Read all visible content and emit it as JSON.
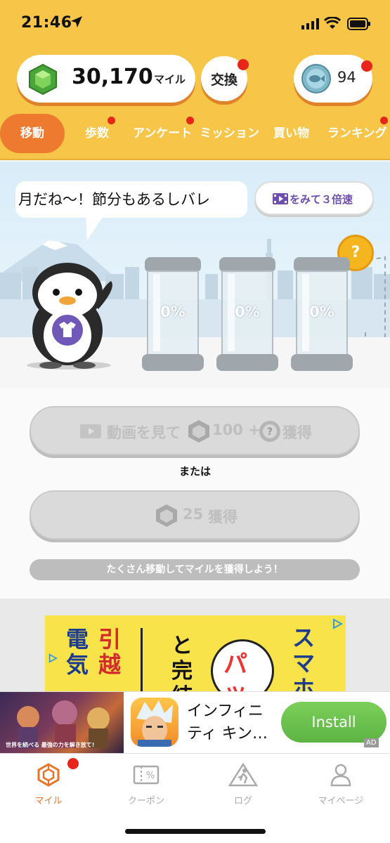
{
  "status_bar": {
    "time": "21:46"
  },
  "header": {
    "miles_value": "30,170",
    "miles_unit": "マイル",
    "exchange_label": "交換",
    "fish_count": "94"
  },
  "tabs": [
    {
      "label": "移動"
    },
    {
      "label": "歩数"
    },
    {
      "label": "アンケート"
    },
    {
      "label": "ミッション"
    },
    {
      "label": "買い物"
    },
    {
      "label": "ランキング"
    }
  ],
  "scene": {
    "speech_text": "月だね〜！節分もあるしバレ",
    "video_boost_label": "をみて３倍速",
    "help_label": "?",
    "jars": [
      {
        "percent": "0%"
      },
      {
        "percent": "0%"
      },
      {
        "percent": "0%"
      }
    ]
  },
  "actions": {
    "video_button": {
      "prefix": "動画を見て",
      "amount": "100 +",
      "suffix": "獲得"
    },
    "or_label": "または",
    "earn_button": {
      "amount": "25",
      "suffix": "獲得"
    },
    "hint": "たくさん移動してマイルを獲得しよう！"
  },
  "ad": {
    "banner_col1": "電気",
    "banner_col2": "引越",
    "banner_col3": "と完結",
    "banner_col4": "パッ",
    "banner_col5": "スマホ",
    "game_caption": "世界を続べる 最強の力を解き放て!",
    "app_name": "インフィニティ キン…",
    "install_label": "Install",
    "ad_badge": "AD"
  },
  "bottom_nav": [
    {
      "label": "マイル",
      "icon": "gem-outline-icon"
    },
    {
      "label": "クーポン",
      "icon": "coupon-icon"
    },
    {
      "label": "ログ",
      "icon": "walk-log-icon"
    },
    {
      "label": "マイページ",
      "icon": "person-icon"
    }
  ],
  "colors": {
    "header_bg": "#f7c548",
    "accent_orange": "#ee7a30",
    "badge_red": "#e8251b",
    "boost_purple": "#6e4fb0",
    "install_green": "#5cb443"
  }
}
